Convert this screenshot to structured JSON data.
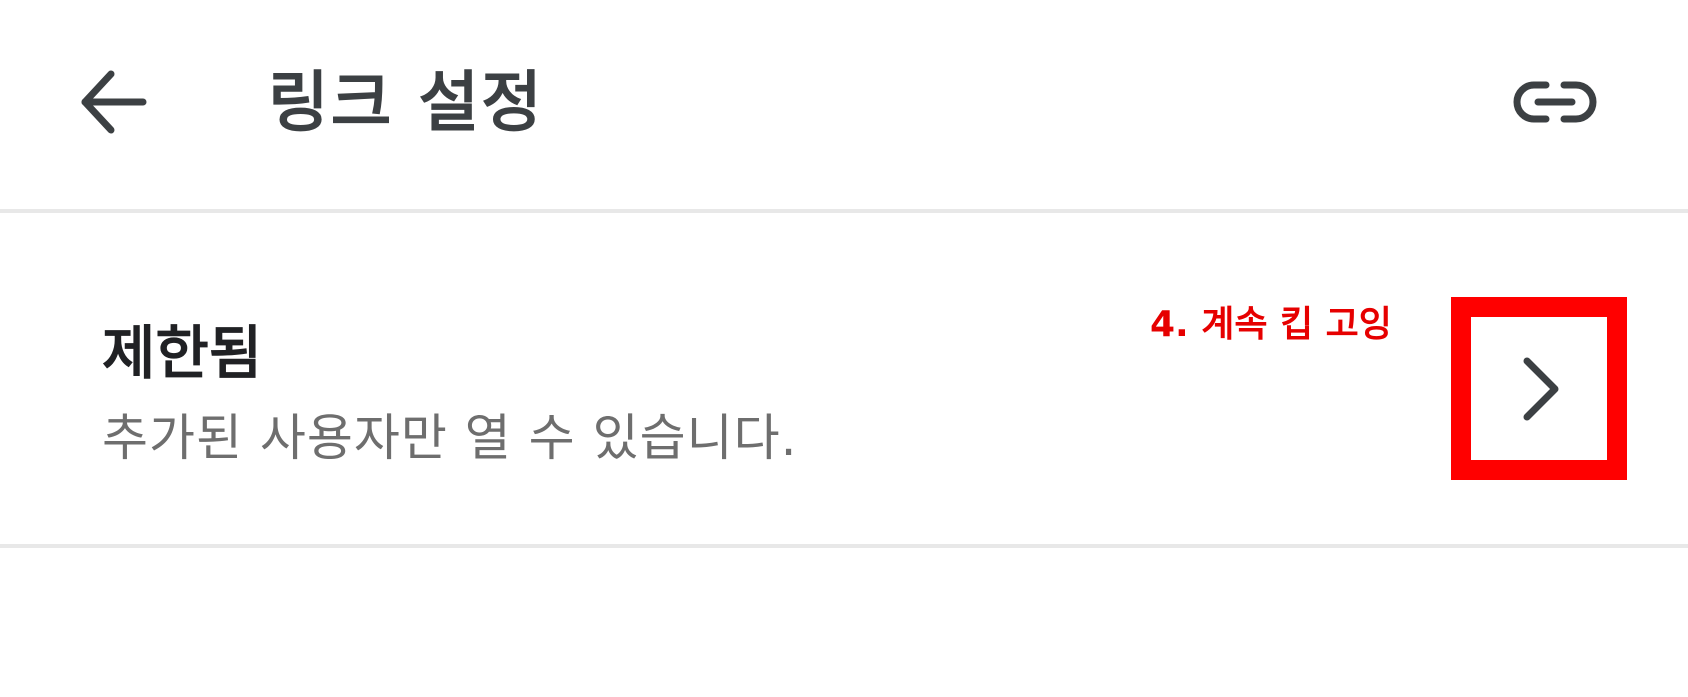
{
  "header": {
    "back_icon": "arrow-back-icon",
    "title": "링크 설정",
    "link_icon": "link-icon"
  },
  "setting": {
    "title": "제한됨",
    "description": "추가된 사용자만 열 수 있습니다.",
    "chevron_icon": "chevron-right-icon"
  },
  "annotation": {
    "text": "4. 계속 킵 고잉",
    "color": "#ff0000"
  },
  "colors": {
    "icon": "#3c4043",
    "divider": "#e8e8e8",
    "highlight": "#ff0000"
  }
}
